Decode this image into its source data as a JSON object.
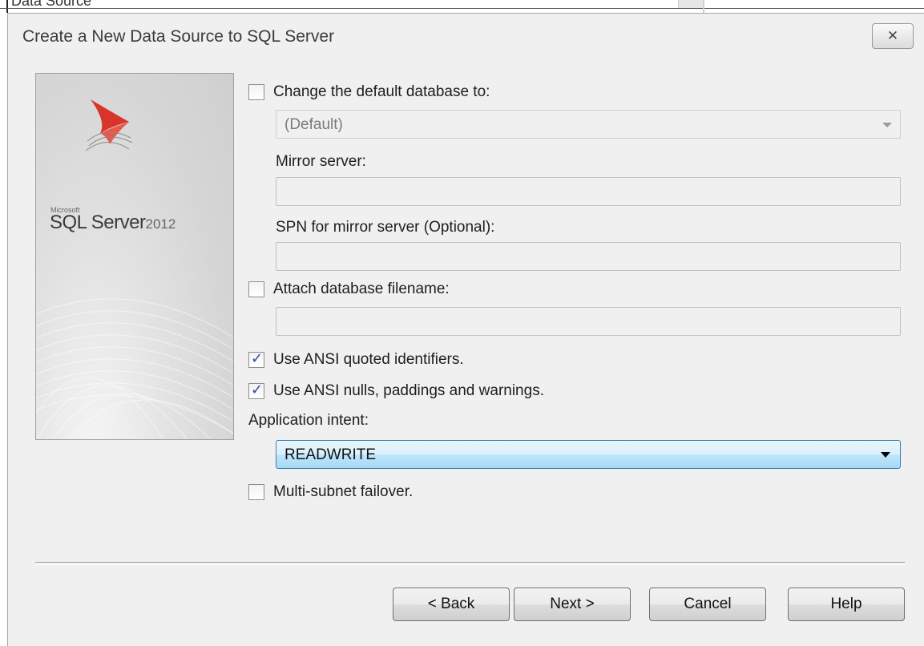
{
  "background_window": {
    "partial_text": "Data Source"
  },
  "dialog": {
    "title": "Create a New Data Source to SQL Server",
    "close_label": "✕"
  },
  "logo": {
    "vendor": "Microsoft",
    "product": "SQL Server",
    "version": "2012"
  },
  "form": {
    "change_default_db": {
      "label": "Change the default database to:",
      "checked": false
    },
    "default_db_value": "(Default)",
    "mirror_server_label": "Mirror server:",
    "mirror_server_value": "",
    "spn_label": "SPN for mirror server (Optional):",
    "spn_value": "",
    "attach_db": {
      "label": "Attach database filename:",
      "checked": false
    },
    "attach_db_value": "",
    "ansi_quoted": {
      "label": "Use ANSI quoted identifiers.",
      "checked": true
    },
    "ansi_nulls": {
      "label": "Use ANSI nulls, paddings and warnings.",
      "checked": true
    },
    "app_intent_label": "Application intent:",
    "app_intent_value": "READWRITE",
    "multi_subnet": {
      "label": "Multi-subnet failover.",
      "checked": false
    }
  },
  "buttons": {
    "back": "< Back",
    "next": "Next >",
    "cancel": "Cancel",
    "help": "Help"
  },
  "colors": {
    "dialog_bg": "#f0f0f0",
    "combo_active": "#bee6fd",
    "check_mark": "#2a4d9a",
    "logo_red": "#d8352a"
  }
}
